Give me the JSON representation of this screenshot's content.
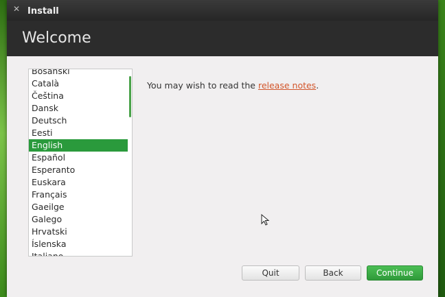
{
  "window": {
    "title": "Install"
  },
  "header": {
    "title": "Welcome"
  },
  "languages": {
    "items": [
      "Bosanski",
      "Català",
      "Čeština",
      "Dansk",
      "Deutsch",
      "Eesti",
      "English",
      "Español",
      "Esperanto",
      "Euskara",
      "Français",
      "Gaeilge",
      "Galego",
      "Hrvatski",
      "Íslenska",
      "Italiano"
    ],
    "selected": "English"
  },
  "main": {
    "text_before": "You may wish to read the ",
    "link_text": "release notes",
    "text_after": "."
  },
  "buttons": {
    "quit": "Quit",
    "back": "Back",
    "continue": "Continue"
  },
  "colors": {
    "accent": "#2a9a3c",
    "link": "#d2552a",
    "header": "#2c2c2c"
  }
}
